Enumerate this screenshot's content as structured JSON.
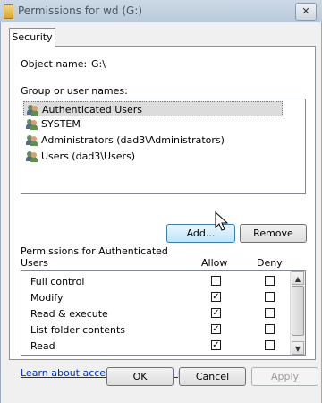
{
  "window": {
    "title": "Permissions for wd (G:)",
    "close_glyph": "✕"
  },
  "tabs": [
    {
      "label": "Security",
      "active": true
    }
  ],
  "object": {
    "label": "Object name:",
    "value": "G:\\"
  },
  "group_section": {
    "label": "Group or user names:",
    "items": [
      {
        "label": "Authenticated Users",
        "selected": true
      },
      {
        "label": "SYSTEM",
        "selected": false
      },
      {
        "label": "Administrators (dad3\\Administrators)",
        "selected": false
      },
      {
        "label": "Users (dad3\\Users)",
        "selected": false
      }
    ],
    "icon": "users-group-icon"
  },
  "buttons": {
    "add": "Add...",
    "remove": "Remove",
    "ok": "OK",
    "cancel": "Cancel",
    "apply": "Apply"
  },
  "permissions": {
    "label_line1": "Permissions for Authenticated",
    "label_line2": "Users",
    "allow_header": "Allow",
    "deny_header": "Deny",
    "rows": [
      {
        "name": "Full control",
        "allow": false,
        "deny": false
      },
      {
        "name": "Modify",
        "allow": true,
        "deny": false
      },
      {
        "name": "Read & execute",
        "allow": true,
        "deny": false
      },
      {
        "name": "List folder contents",
        "allow": true,
        "deny": false
      },
      {
        "name": "Read",
        "allow": true,
        "deny": false
      }
    ]
  },
  "link": "Learn about access control and permissions",
  "check_glyph": "✓",
  "scroll": {
    "up_glyph": "▲",
    "down_glyph": "▼"
  }
}
